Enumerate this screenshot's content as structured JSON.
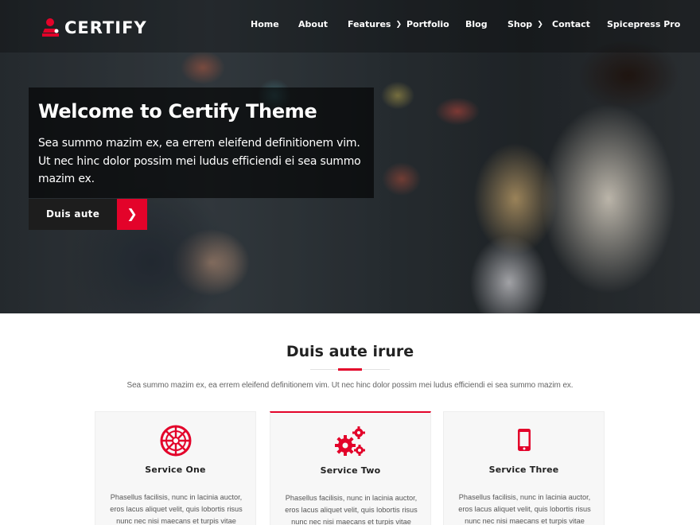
{
  "brand": {
    "name": "CERTIFY",
    "accent_color": "#e3032a"
  },
  "nav": {
    "items": [
      {
        "label": "Home",
        "caret": false
      },
      {
        "label": "About",
        "caret": false
      },
      {
        "label": "Features",
        "caret": true
      },
      {
        "label": "Portfolio",
        "caret": false
      },
      {
        "label": "Blog",
        "caret": false
      },
      {
        "label": "Shop",
        "caret": true
      },
      {
        "label": "Contact",
        "caret": false
      },
      {
        "label": "Spicepress Pro",
        "caret": false
      }
    ]
  },
  "hero": {
    "title": "Welcome to Certify Theme",
    "text": "Sea summo mazim ex, ea errem eleifend definitionem vim. Ut nec hinc dolor possim mei ludus efficiendi ei sea summo mazim ex.",
    "button_label": "Duis aute",
    "button_icon": "chevron-right-icon"
  },
  "services": {
    "title": "Duis aute irure",
    "description": "Sea summo mazim ex, ea errem eleifend definitionem vim. Ut nec hinc dolor possim mei ludus efficiendi ei sea summo mazim ex.",
    "cards": [
      {
        "title": "Service One",
        "icon": "galactic-empire-icon",
        "text": "Phasellus facilisis, nunc in lacinia auctor, eros lacus aliquet velit, quis lobortis risus nunc nec nisi maecans et turpis vitae velit.volutpat"
      },
      {
        "title": "Service Two",
        "icon": "gears-icon",
        "text": "Phasellus facilisis, nunc in lacinia auctor, eros lacus aliquet velit, quis lobortis risus nunc nec nisi maecans et turpis vitae velit.volutpat"
      },
      {
        "title": "Service Three",
        "icon": "mobile-phone-icon",
        "text": "Phasellus facilisis, nunc in lacinia auctor, eros lacus aliquet velit, quis lobortis risus nunc nec nisi maecans et turpis vitae velit.volutpat"
      }
    ]
  }
}
